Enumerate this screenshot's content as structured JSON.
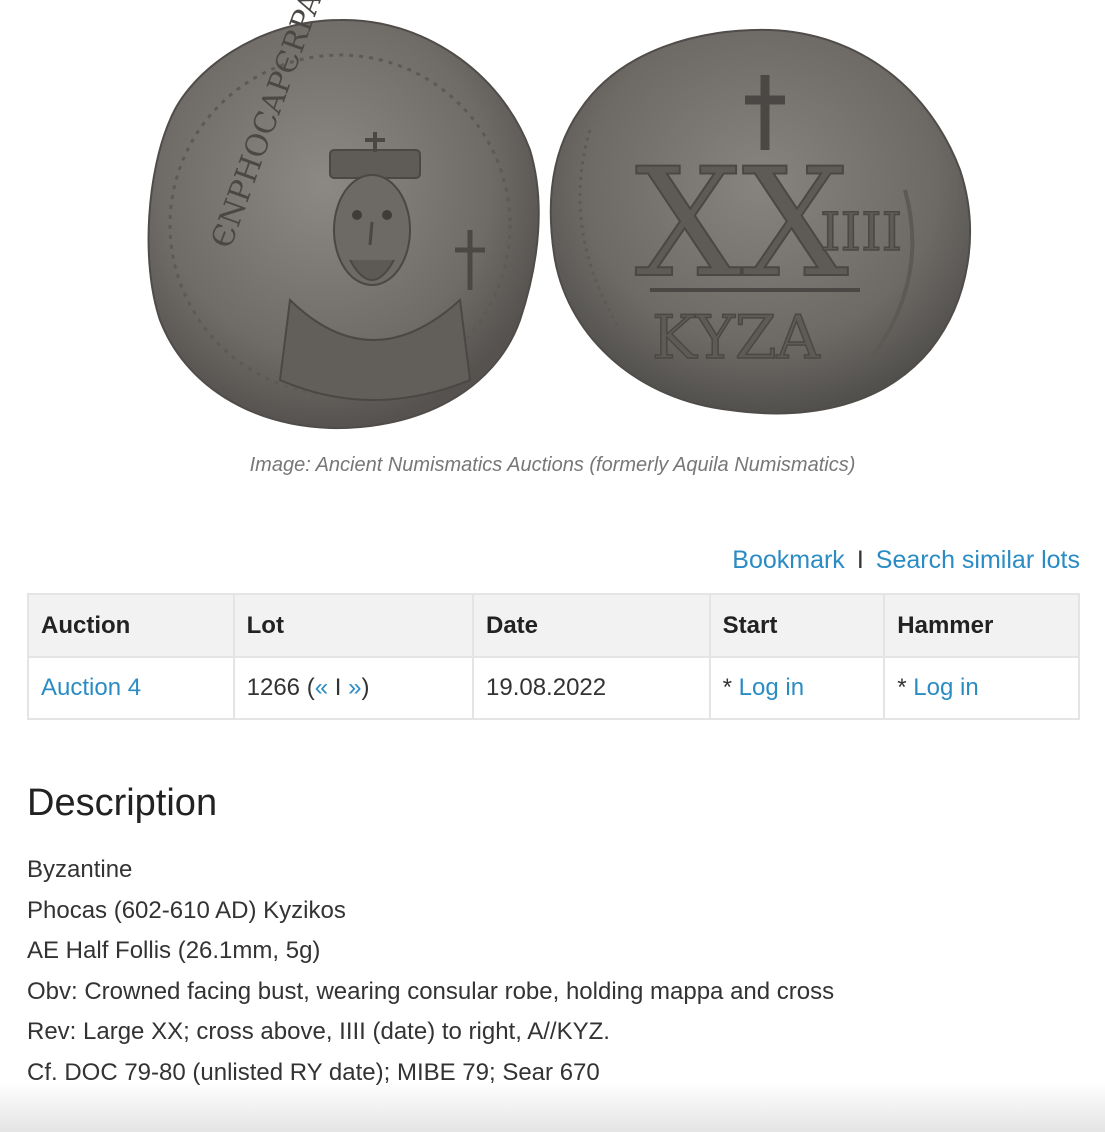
{
  "image": {
    "caption": "Image: Ancient Numismatics Auctions (formerly Aquila Numismatics)",
    "obverse_legend": "ЄNPHOCAPЄRPAVG",
    "reverse_value": "XX",
    "reverse_date": "IIII",
    "reverse_mint": "KYZA"
  },
  "actions": {
    "bookmark": "Bookmark",
    "separator": "I",
    "search_similar": "Search similar lots"
  },
  "table": {
    "headers": {
      "auction": "Auction",
      "lot": "Lot",
      "date": "Date",
      "start": "Start",
      "hammer": "Hammer"
    },
    "row": {
      "auction": "Auction 4",
      "lot_number": "1266 (",
      "prev": "«",
      "lot_sep": " I ",
      "next": "»",
      "lot_close": ")",
      "date": "19.08.2022",
      "start_prefix": "* ",
      "start_link": "Log in",
      "hammer_prefix": "* ",
      "hammer_link": "Log in"
    }
  },
  "description": {
    "title": "Description",
    "lines": [
      "Byzantine",
      "Phocas (602-610 AD) Kyzikos",
      "AE Half Follis (26.1mm, 5g)",
      "Obv: Crowned facing bust, wearing consular robe, holding mappa and cross",
      "Rev: Large XX; cross above, IIII (date) to right, A//KYZ.",
      "Cf. DOC 79-80 (unlisted RY date); MIBE 79; Sear 670"
    ]
  },
  "colors": {
    "link": "#2b8cc4",
    "coin_metal": "#7d7a76",
    "header_bg": "#f2f2f2"
  }
}
